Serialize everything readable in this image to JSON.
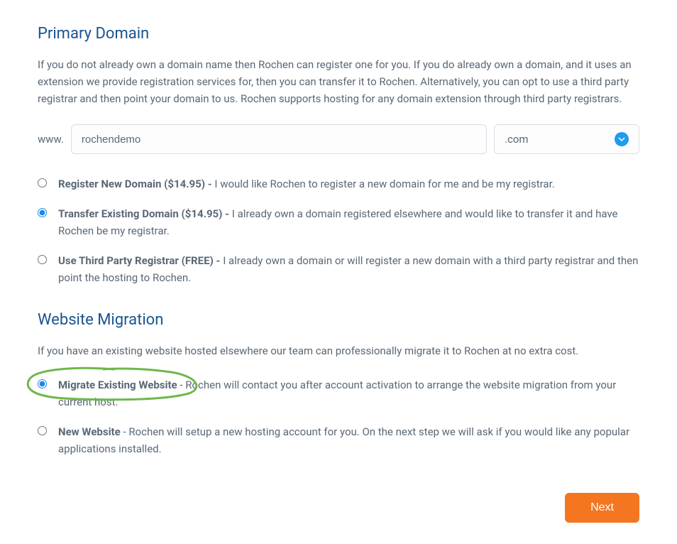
{
  "primary": {
    "heading": "Primary Domain",
    "description": "If you do not already own a domain name then Rochen can register one for you. If you do already own a domain, and it uses an extension we provide registration services for, then you can transfer it to Rochen. Alternatively, you can opt to use a third party registrar and then point your domain to us. Rochen supports hosting for any domain extension through third party registrars.",
    "www_prefix": "www.",
    "domain_value": "rochendemo",
    "tld_value": ".com",
    "options": [
      {
        "bold": "Register New Domain ($14.95) - ",
        "text": "I would like Rochen to register a new domain for me and be my registrar.",
        "selected": false
      },
      {
        "bold": "Transfer Existing Domain ($14.95) - ",
        "text": "I already own a domain registered elsewhere and would like to transfer it and have Rochen be my registrar.",
        "selected": true
      },
      {
        "bold": "Use Third Party Registrar (FREE) - ",
        "text": "I already own a domain or will register a new domain with a third party registrar and then point the hosting to Rochen.",
        "selected": false
      }
    ]
  },
  "migration": {
    "heading": "Website Migration",
    "description": "If you have an existing website hosted elsewhere our team can professionally migrate it to Rochen at no extra cost.",
    "options": [
      {
        "bold": "Migrate Existing Website",
        "sep": " - ",
        "text": "Rochen will contact you after account activation to arrange the website migration from your current host.",
        "selected": true
      },
      {
        "bold": "New Website",
        "sep": " - ",
        "text": "Rochen will setup a new hosting account for you. On the next step we will ask if you would like any popular applications installed.",
        "selected": false
      }
    ]
  },
  "footer": {
    "next_label": "Next"
  }
}
